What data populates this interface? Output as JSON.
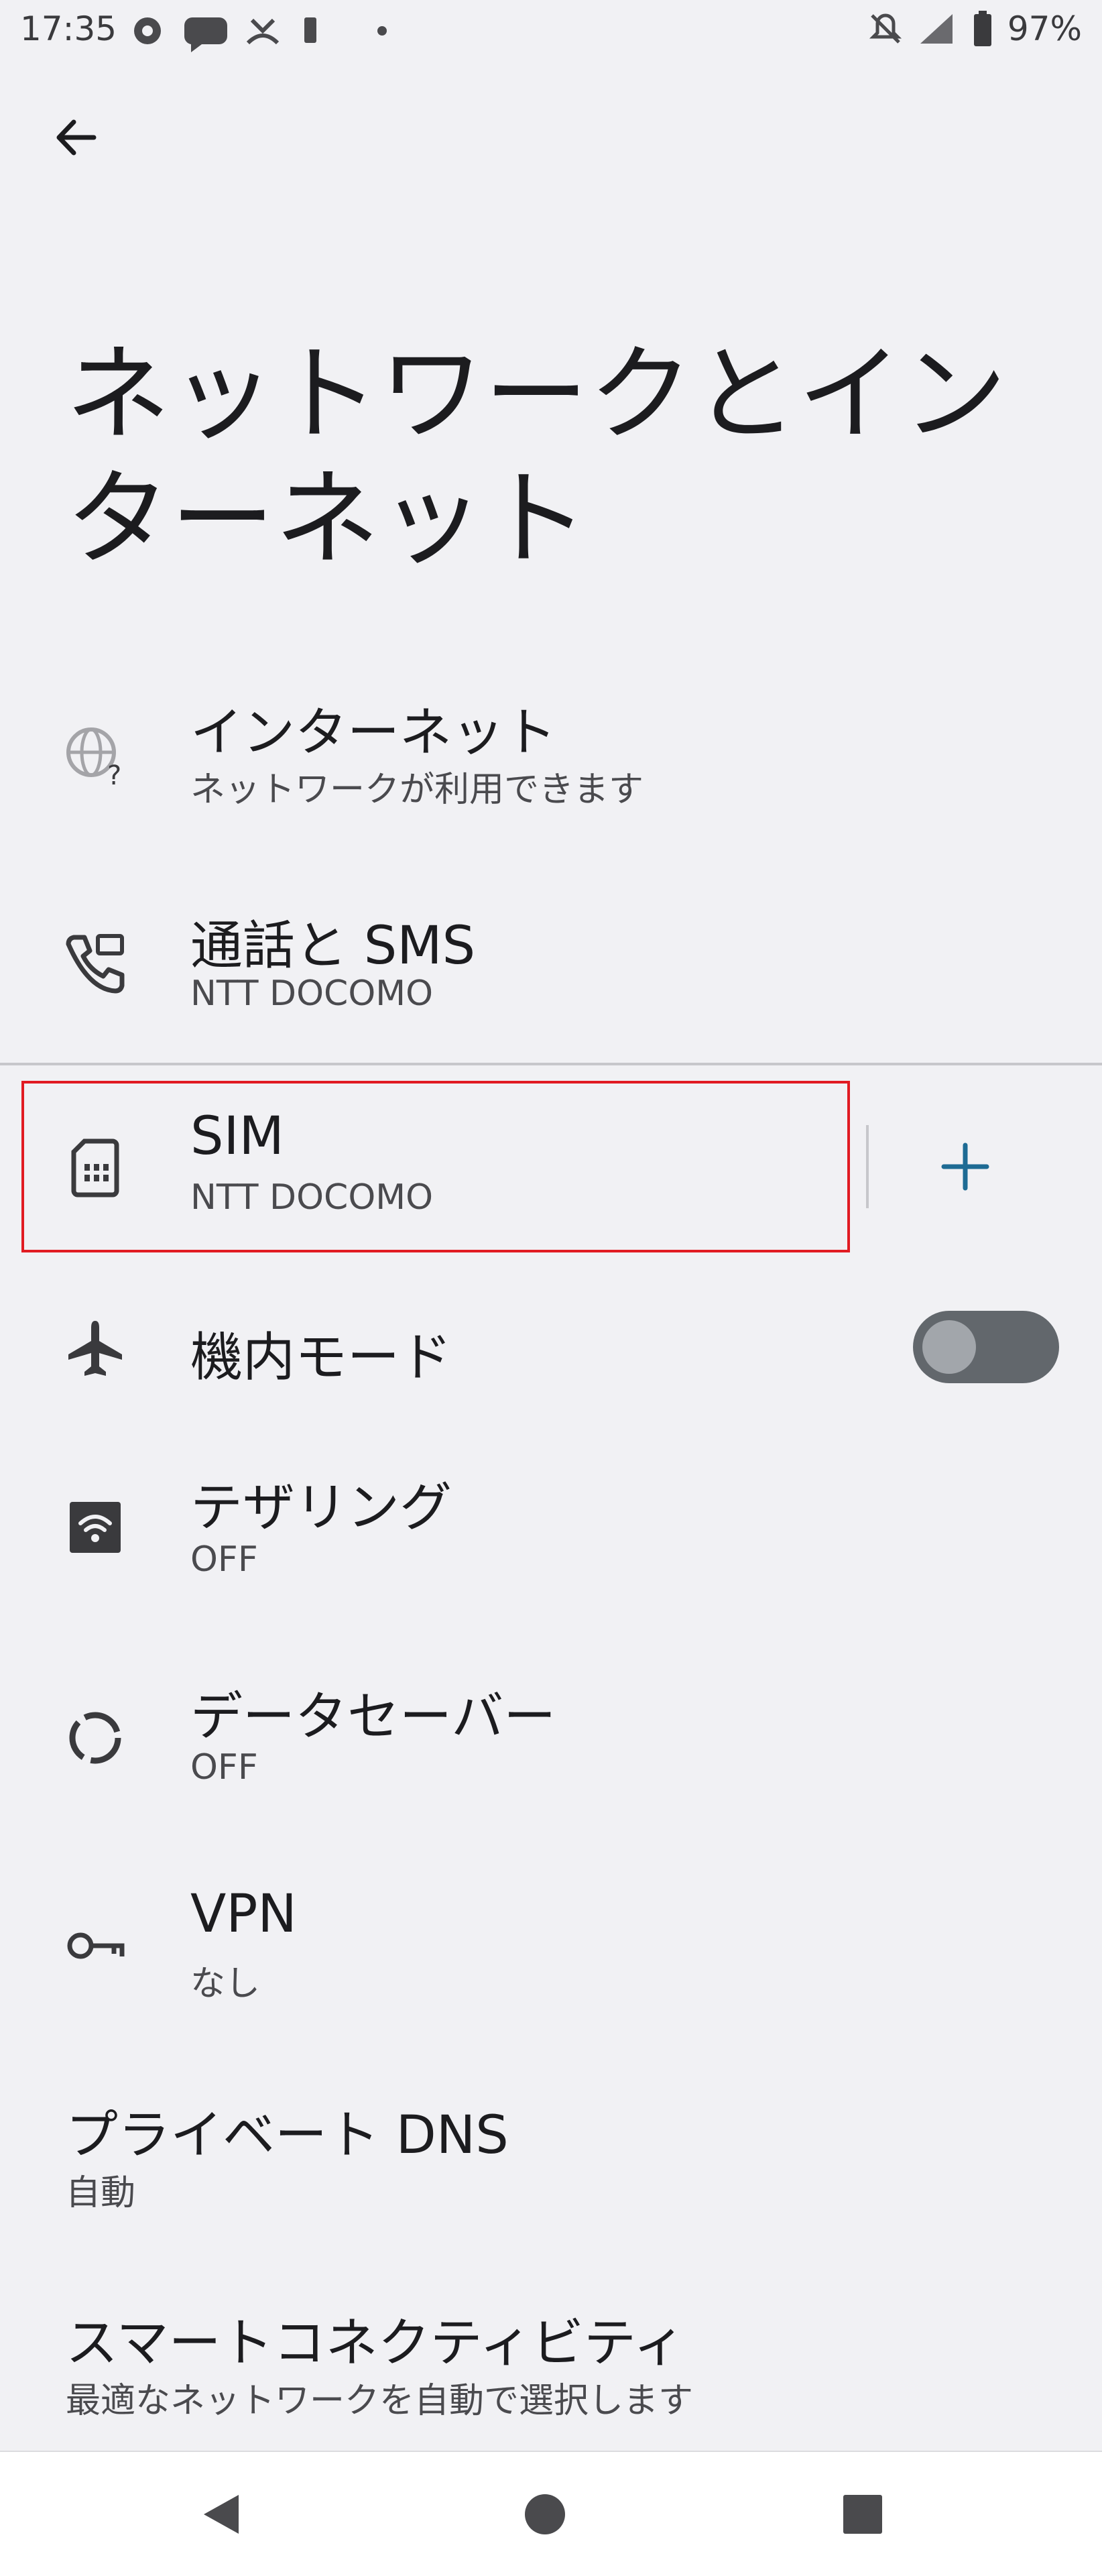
{
  "status_bar": {
    "time": "17:35",
    "battery": "97%",
    "icons": [
      "gear-icon",
      "chat-bubble-icon",
      "missed-call-icon",
      "vibrate-icon",
      "dot-icon",
      "notifications-off-icon",
      "signal-icon",
      "battery-icon"
    ]
  },
  "header": {
    "back_icon": "arrow-back-icon",
    "title": "ネットワークとインターネット"
  },
  "items": [
    {
      "icon": "globe-question-icon",
      "title": "インターネット",
      "subtitle": "ネットワークが利用できます"
    },
    {
      "icon": "phone-sms-icon",
      "title": "通話と SMS",
      "subtitle": "NTT DOCOMO"
    },
    {
      "icon": "sim-card-icon",
      "title": "SIM",
      "subtitle": "NTT DOCOMO",
      "action_icon": "plus-icon"
    },
    {
      "icon": "airplane-icon",
      "title": "機内モード",
      "toggle": "off"
    },
    {
      "icon": "hotspot-icon",
      "title": "テザリング",
      "subtitle": "OFF"
    },
    {
      "icon": "data-saver-icon",
      "title": "データセーバー",
      "subtitle": "OFF"
    },
    {
      "icon": "vpn-key-icon",
      "title": "VPN",
      "subtitle": "なし"
    },
    {
      "title": "プライベート DNS",
      "subtitle": "自動"
    },
    {
      "title": "スマートコネクティビティ",
      "subtitle": "最適なネットワークを自動で選択します"
    }
  ],
  "nav": {
    "icons": [
      "back-triangle-icon",
      "home-circle-icon",
      "recents-square-icon"
    ]
  },
  "colors": {
    "background": "#f1f1f4",
    "highlight": "#e11b22",
    "accent": "#1e6b94",
    "toggle_track": "#62676c"
  }
}
